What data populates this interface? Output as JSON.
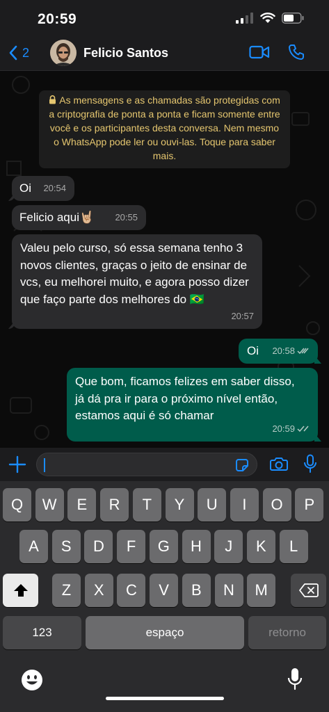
{
  "status": {
    "time": "20:59"
  },
  "header": {
    "back_count": "2",
    "contact_name": "Felicio Santos"
  },
  "notice": {
    "text": "As mensagens e as chamadas são protegidas com a criptografia de ponta a ponta e ficam somente entre você e os participantes desta conversa. Nem mesmo o WhatsApp pode ler ou ouvi-las. Toque para saber mais."
  },
  "messages": [
    {
      "text": "Oi",
      "time": "20:54",
      "direction": "incoming"
    },
    {
      "text": "Felicio aqui🤘🏼",
      "time": "20:55",
      "direction": "incoming"
    },
    {
      "text": "Valeu pelo curso, só essa semana tenho 3 novos clientes, graças o jeito de ensinar de vcs, eu melhorei muito, e agora posso dizer que faço parte dos melhores do 🇧🇷",
      "time": "20:57",
      "direction": "incoming"
    },
    {
      "text": "Oi",
      "time": "20:58",
      "direction": "outgoing"
    },
    {
      "text": "Que bom, ficamos felizes em saber disso, já dá pra ir para o próximo nível então, estamos aqui é só chamar",
      "time": "20:59",
      "direction": "outgoing"
    }
  ],
  "input": {
    "value": ""
  },
  "keyboard": {
    "row1": [
      "Q",
      "W",
      "E",
      "R",
      "T",
      "Y",
      "U",
      "I",
      "O",
      "P"
    ],
    "row2": [
      "A",
      "S",
      "D",
      "F",
      "G",
      "H",
      "J",
      "K",
      "L"
    ],
    "row3": [
      "Z",
      "X",
      "C",
      "V",
      "B",
      "N",
      "M"
    ],
    "numbers_label": "123",
    "space_label": "espaço",
    "return_label": "retorno"
  },
  "colors": {
    "accent": "#1a8cff",
    "outgoing_bubble": "#005c4b",
    "incoming_bubble": "#2b2b2d",
    "notice_text": "#e5c66f"
  }
}
